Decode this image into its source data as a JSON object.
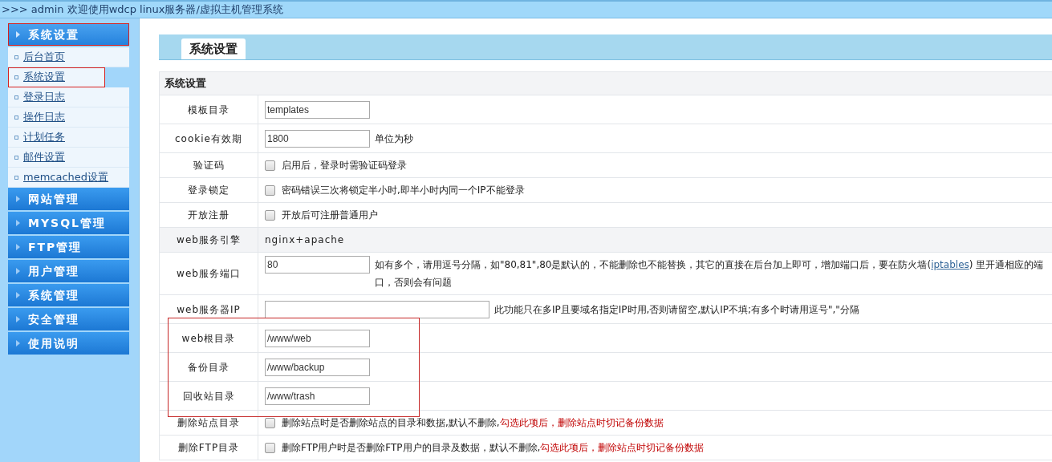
{
  "top_bar": {
    "text": ">>> admin 欢迎使用wdcp linux服务器/虚拟主机管理系统"
  },
  "sidebar": {
    "groups": [
      {
        "label": "系统设置",
        "expanded": true,
        "highlighted": true,
        "items": [
          {
            "label": "后台首页",
            "highlighted": false
          },
          {
            "label": "系统设置",
            "highlighted": true
          },
          {
            "label": "登录日志",
            "highlighted": false
          },
          {
            "label": "操作日志",
            "highlighted": false
          },
          {
            "label": "计划任务",
            "highlighted": false
          },
          {
            "label": "邮件设置",
            "highlighted": false
          },
          {
            "label": "memcached设置",
            "highlighted": false
          }
        ]
      },
      {
        "label": "网站管理",
        "expanded": false,
        "highlighted": false
      },
      {
        "label": "MYSQL管理",
        "expanded": false,
        "highlighted": false
      },
      {
        "label": "FTP管理",
        "expanded": false,
        "highlighted": false
      },
      {
        "label": "用户管理",
        "expanded": false,
        "highlighted": false
      },
      {
        "label": "系统管理",
        "expanded": false,
        "highlighted": false
      },
      {
        "label": "安全管理",
        "expanded": false,
        "highlighted": false
      },
      {
        "label": "使用说明",
        "expanded": false,
        "highlighted": false
      }
    ]
  },
  "tabs": [
    {
      "label": "系统设置",
      "selected": true
    }
  ],
  "table": {
    "section_title": "系统设置",
    "rows": [
      {
        "label": "模板目录",
        "kind": "input",
        "value": "templates",
        "wide": false,
        "highlighted": false
      },
      {
        "label": "cookie有效期",
        "kind": "input",
        "value": "1800",
        "wide": false,
        "note": "单位为秒",
        "highlighted": false
      },
      {
        "label": "验证码",
        "kind": "checkbox",
        "checked": false,
        "note": "启用后，登录时需验证码登录",
        "highlighted": false
      },
      {
        "label": "登录锁定",
        "kind": "checkbox",
        "checked": false,
        "note": "密码错误三次将锁定半小时,即半小时内同一个IP不能登录",
        "highlighted": false
      },
      {
        "label": "开放注册",
        "kind": "checkbox",
        "checked": false,
        "note": "开放后可注册普通用户",
        "highlighted": false
      },
      {
        "label": "web服务引擎",
        "kind": "text",
        "value": "nginx+apache",
        "highlighted": false
      },
      {
        "label": "web服务端口",
        "kind": "input",
        "value": "80",
        "wide": false,
        "note": "如有多个，请用逗号分隔，如\"80,81\",80是默认的，不能删除也不能替换，其它的直接在后台加上即可，增加端口后，要在防火墙(",
        "link": "iptables",
        "note_after": ") 里开通相应的端口，否则会有问题",
        "highlighted": false
      },
      {
        "label": "web服务器IP",
        "kind": "input",
        "value": "",
        "wide": true,
        "note": "此功能只在多IP且要域名指定IP时用,否则请留空,默认IP不填;有多个时请用逗号\",\"分隔",
        "highlighted": false
      },
      {
        "label": "web根目录",
        "kind": "input",
        "value": "/www/web",
        "wide": false,
        "highlighted": true
      },
      {
        "label": "备份目录",
        "kind": "input",
        "value": "/www/backup",
        "wide": false,
        "highlighted": true
      },
      {
        "label": "回收站目录",
        "kind": "input",
        "value": "/www/trash",
        "wide": false,
        "highlighted": true
      },
      {
        "label": "删除站点目录",
        "kind": "checkbox",
        "checked": false,
        "note": "删除站点时是否删除站点的目录和数据,默认不删除,",
        "warning": "勾选此项后，删除站点时切记备份数据",
        "highlighted": false
      },
      {
        "label": "删除FTP目录",
        "kind": "checkbox",
        "checked": false,
        "note": "删除FTP用户时是否删除FTP用户的目录及数据，默认不删除,",
        "warning": "勾选此项后，删除站点时切记备份数据",
        "highlighted": false
      }
    ]
  }
}
